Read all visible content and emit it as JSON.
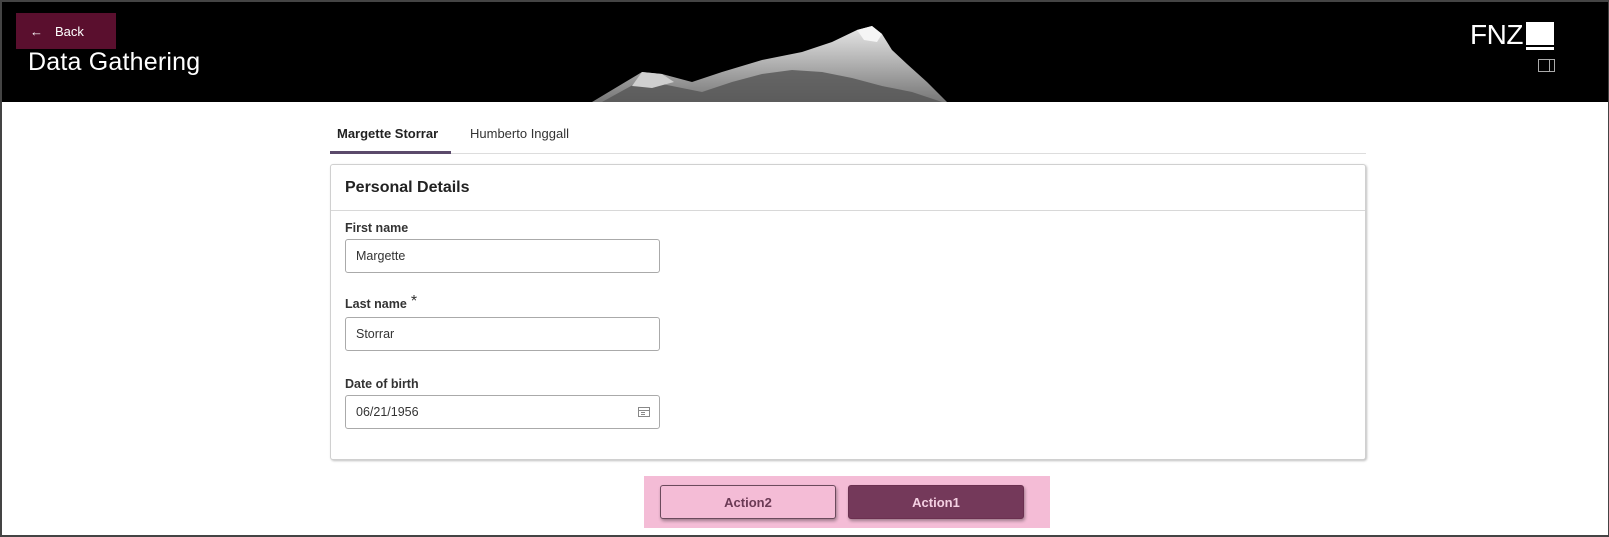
{
  "header": {
    "back_label": "Back",
    "back_icon": "arrow-left-icon",
    "title": "Data Gathering",
    "logo_text": "FNZ",
    "panel_icon": "panel-toggle-icon"
  },
  "tabs": [
    {
      "label": "Margette Storrar",
      "active": true
    },
    {
      "label": "Humberto Inggall",
      "active": false
    }
  ],
  "card": {
    "title": "Personal Details",
    "fields": {
      "first_name": {
        "label": "First name",
        "value": "Margette"
      },
      "last_name": {
        "label": "Last name",
        "required_mark": "*",
        "value": "Storrar"
      },
      "dob": {
        "label": "Date of birth",
        "value": "06/21/1956",
        "icon": "calendar-icon"
      }
    }
  },
  "actions": {
    "secondary_label": "Action2",
    "primary_label": "Action1",
    "highlight_color": "#f4bcd6",
    "primary_color": "#74395a"
  },
  "colors": {
    "header_bg": "#000000",
    "back_button_bg": "#5a0f2e",
    "tab_active_underline": "#5b4a6b"
  }
}
